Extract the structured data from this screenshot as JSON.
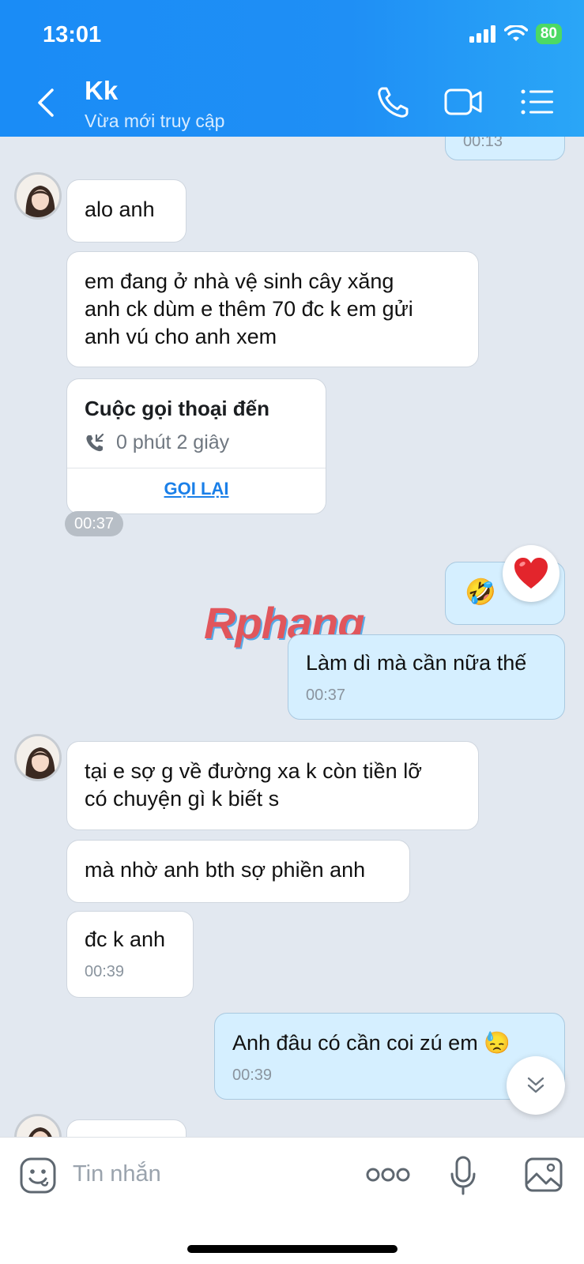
{
  "status_bar": {
    "time": "13:01",
    "battery": "80"
  },
  "header": {
    "contact_name": "Kk",
    "contact_status": "Vừa mới truy cập"
  },
  "chat": {
    "partial_top_time": "00:13",
    "messages": [
      {
        "text": "alo anh"
      },
      {
        "text": "em đang ở nhà vệ sinh cây xăng\nanh ck dùm e thêm 70 đc k em gửi\nanh vú cho anh xem"
      },
      {
        "text": "Làm dì mà cần nữa thế",
        "time": "00:37"
      },
      {
        "text": "tại e sợ g về đường xa k còn tiền lỡ\ncó chuyện gì k biết s"
      },
      {
        "text": "mà nhờ anh bth sợ phiền anh"
      },
      {
        "text": "đc k anh",
        "time": "00:39"
      },
      {
        "text": "Anh đâu có cần coi zú em 😓",
        "time": "00:39"
      }
    ],
    "call_card": {
      "title": "Cuộc gọi thoại đến",
      "duration": "0 phút 2 giây",
      "action": "GỌI LẠI"
    },
    "call_time": "00:37",
    "emoji_message": "🤣",
    "reaction": "heart",
    "watermark": "Rphang"
  },
  "composer": {
    "placeholder": "Tin nhắn"
  }
}
